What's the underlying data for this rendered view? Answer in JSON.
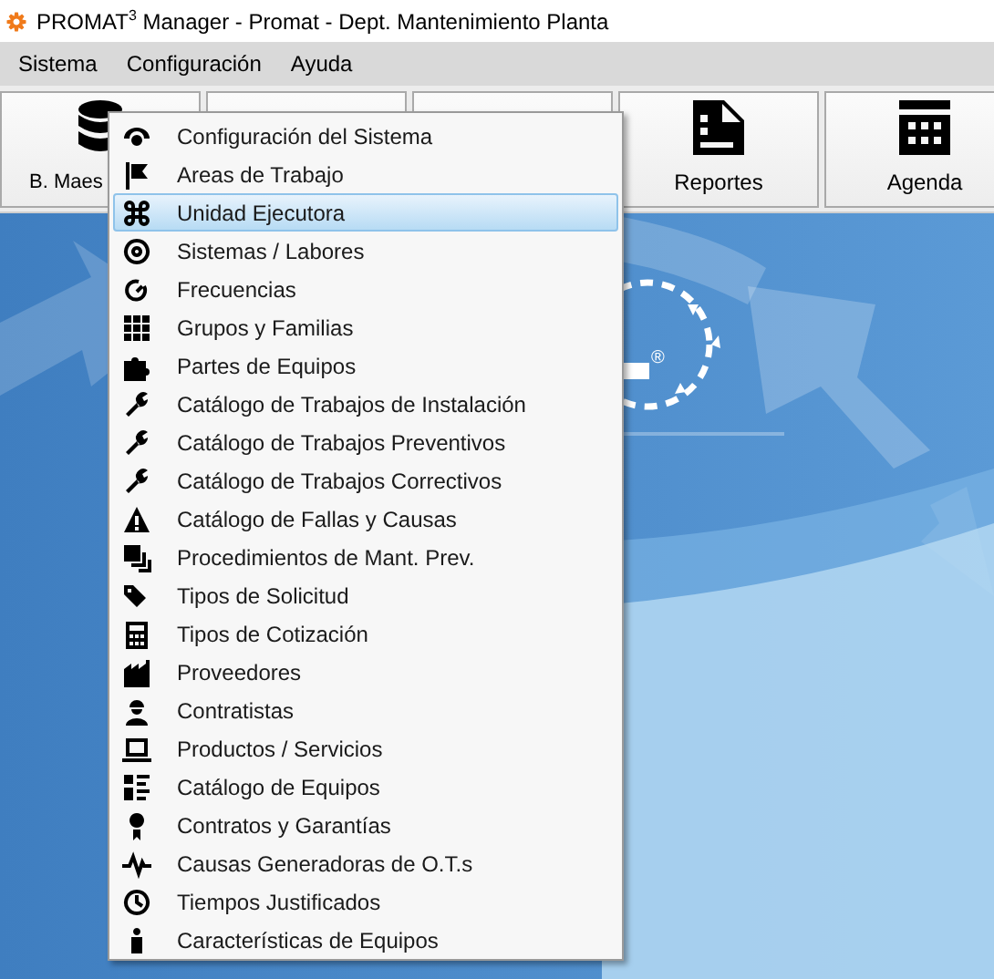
{
  "window": {
    "title": "PROMAT$^{3}$ Manager - Promat - Dept. Mantenimiento Planta"
  },
  "menu_bar": [
    {
      "label": "Sistema"
    },
    {
      "label": "Configuración"
    },
    {
      "label": "Ayuda"
    }
  ],
  "toolbar": [
    {
      "kind": "labeled",
      "label": "B. Maes"
    },
    {
      "kind": "blank"
    },
    {
      "kind": "blank"
    },
    {
      "kind": "labeled",
      "label": "Reportes"
    },
    {
      "kind": "labeled",
      "label": "Agenda"
    }
  ],
  "background": {
    "mark": "®"
  },
  "dropdown_menu": [
    {
      "label": "Configuración del Sistema",
      "selected": false
    },
    {
      "label": "Areas de Trabajo",
      "selected": false
    },
    {
      "label": "Unidad Ejecutora",
      "selected": true
    },
    {
      "label": "Sistemas / Labores",
      "selected": false
    },
    {
      "label": "Frecuencias",
      "selected": false
    },
    {
      "label": "Grupos y Familias",
      "selected": false
    },
    {
      "label": "Partes de Equipos",
      "selected": false
    },
    {
      "label": "Catálogo de Trabajos de Instalación",
      "selected": false
    },
    {
      "label": "Catálogo de Trabajos Preventivos",
      "selected": false
    },
    {
      "label": "Catálogo de Trabajos Correctivos",
      "selected": false
    },
    {
      "label": "Catálogo de Fallas y Causas",
      "selected": false
    },
    {
      "label": "Procedimientos de Mant. Prev.",
      "selected": false
    },
    {
      "label": "Tipos de Solicitud",
      "selected": false
    },
    {
      "label": "Tipos de Cotización",
      "selected": false
    },
    {
      "label": "Proveedores",
      "selected": false
    },
    {
      "label": "Contratistas",
      "selected": false
    },
    {
      "label": "Productos / Servicios",
      "selected": false
    },
    {
      "label": "Catálogo de Equipos",
      "selected": false
    },
    {
      "label": "Contratos y Garantías",
      "selected": false
    },
    {
      "label": "Causas Generadoras de O.T.s",
      "selected": false
    },
    {
      "label": "Tiempos Justificados",
      "selected": false
    },
    {
      "label": "Características de Equipos",
      "selected": false
    }
  ]
}
